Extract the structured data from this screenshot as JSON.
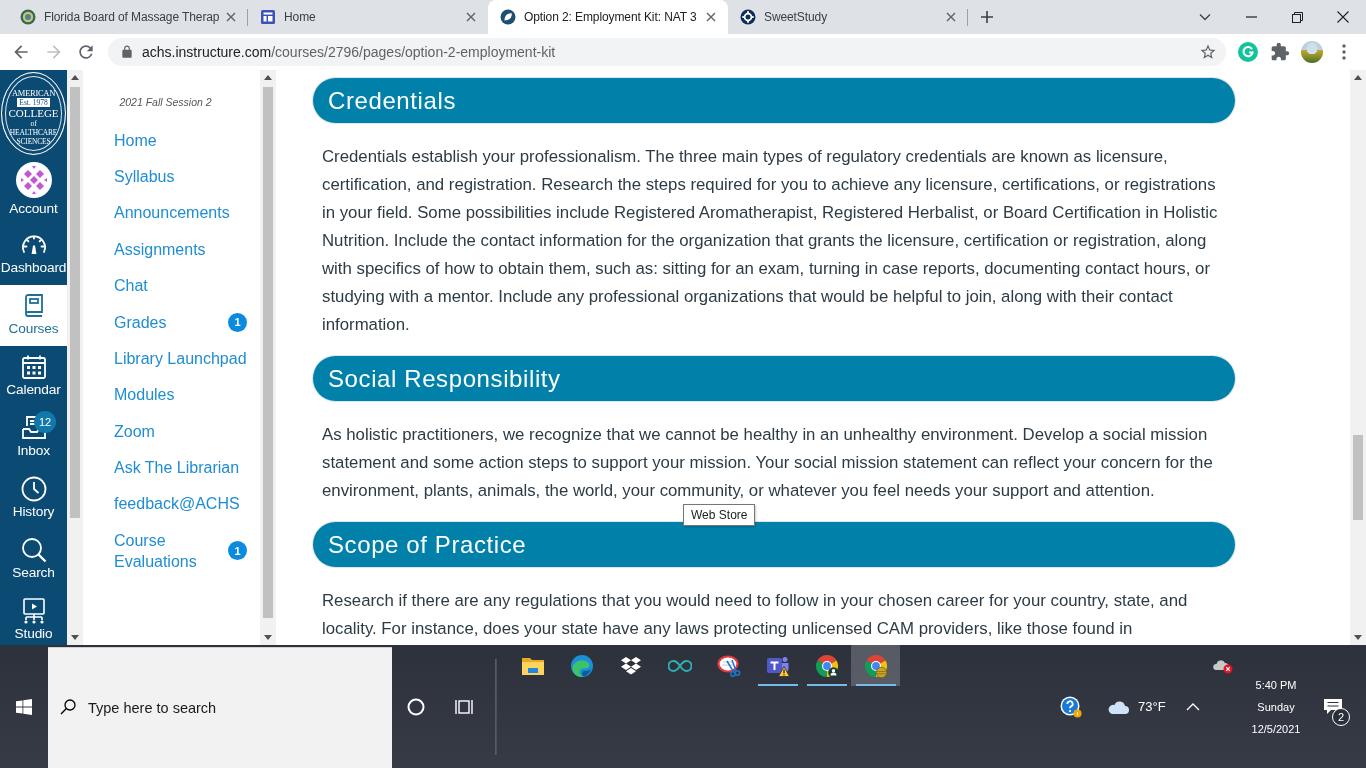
{
  "browser": {
    "tabs": [
      {
        "kind": "seal",
        "title": "Florida Board of Massage Therap",
        "selected": false
      },
      {
        "kind": "layout",
        "title": "Home",
        "selected": false
      },
      {
        "kind": "leaf",
        "title": "Option 2: Employment Kit: NAT 3",
        "selected": true
      },
      {
        "kind": "ring",
        "title": "SweetStudy",
        "selected": false
      }
    ],
    "toolbar": {
      "back": {
        "disabled": false
      },
      "forward": {
        "disabled": true
      },
      "address": {
        "host": "achs.instructure.com",
        "path": "/courses/2796/pages/option-2-employment-kit"
      }
    }
  },
  "global_nav": {
    "logo": {
      "top": "AMERICAN",
      "est": "Est. 1978",
      "middle": "COLLEGE",
      "of": "of",
      "bottom": "HEALTHCARE SCIENCES"
    },
    "items": [
      {
        "kind": "account",
        "label": "Account",
        "selected": false
      },
      {
        "kind": "dashboard",
        "label": "Dashboard",
        "selected": false
      },
      {
        "kind": "courses",
        "label": "Courses",
        "selected": true
      },
      {
        "kind": "calendar",
        "label": "Calendar",
        "selected": false
      },
      {
        "kind": "inbox",
        "label": "Inbox",
        "selected": false,
        "badge": "12"
      },
      {
        "kind": "history",
        "label": "History",
        "selected": false
      },
      {
        "kind": "search",
        "label": "Search",
        "selected": false
      },
      {
        "kind": "studio",
        "label": "Studio",
        "selected": false
      }
    ]
  },
  "course_nav": {
    "term": "2021 Fall Session 2",
    "links": [
      {
        "label": "Home"
      },
      {
        "label": "Syllabus"
      },
      {
        "label": "Announcements"
      },
      {
        "label": "Assignments"
      },
      {
        "label": "Chat"
      },
      {
        "label": "Grades",
        "badge": "1"
      },
      {
        "label": "Library Launchpad"
      },
      {
        "label": "Modules"
      },
      {
        "label": "Zoom"
      },
      {
        "label": "Ask The Librarian"
      },
      {
        "label": "feedback@ACHS"
      },
      {
        "label": "Course Evaluations",
        "badge": "1"
      }
    ]
  },
  "content": {
    "sections": [
      {
        "heading": "Credentials",
        "body": "Credentials establish your professionalism. The three main types of regulatory credentials are known as licensure, certification, and registration. Research the steps required for you to achieve any licensure, certifications, or registrations in your field. Some possibilities include Registered Aromatherapist, Registered Herbalist, or Board Certification in Holistic Nutrition. Include the contact information for the organization that grants the licensure, certification or registration, along with specifics of how to obtain them, such as: sitting for an exam, turning in case reports, documenting contact hours, or studying with a mentor. Include any professional organizations that would be helpful to join, along with their contact information."
      },
      {
        "heading": "Social Responsibility",
        "body": "As holistic practitioners, we recognize that we cannot be healthy in an unhealthy environment. Develop a social mission statement and some action steps to support your mission. Your social mission statement can reflect your concern for the environment, plants, animals, the world, your community, or whatever you feel needs your support and attention."
      },
      {
        "heading": "Scope of Practice",
        "body": "Research if there are any regulations that you would need to follow in your chosen career for your country, state, and locality. For instance, does your state have any laws protecting unlicensed CAM providers, like those found in"
      }
    ]
  },
  "tooltip": {
    "text": "Web Store"
  },
  "taskbar": {
    "search": {
      "placeholder": "Type here to search"
    },
    "apps": [
      {
        "kind": "folder",
        "running": false,
        "selected": false
      },
      {
        "kind": "wave",
        "running": false,
        "selected": false
      },
      {
        "kind": "boxes",
        "running": false,
        "selected": false
      },
      {
        "kind": "infinity",
        "running": false,
        "selected": false
      },
      {
        "kind": "scissors",
        "running": false,
        "selected": false
      },
      {
        "kind": "team",
        "running": true,
        "selected": false
      },
      {
        "kind": "browser-person",
        "running": true,
        "selected": false
      },
      {
        "kind": "browser-photo",
        "running": true,
        "selected": true
      }
    ],
    "weather": {
      "temperature": "73°F"
    },
    "clock": {
      "time": "5:40 PM",
      "day": "Sunday",
      "date": "12/5/2021"
    },
    "notifications": {
      "count": "2"
    }
  }
}
